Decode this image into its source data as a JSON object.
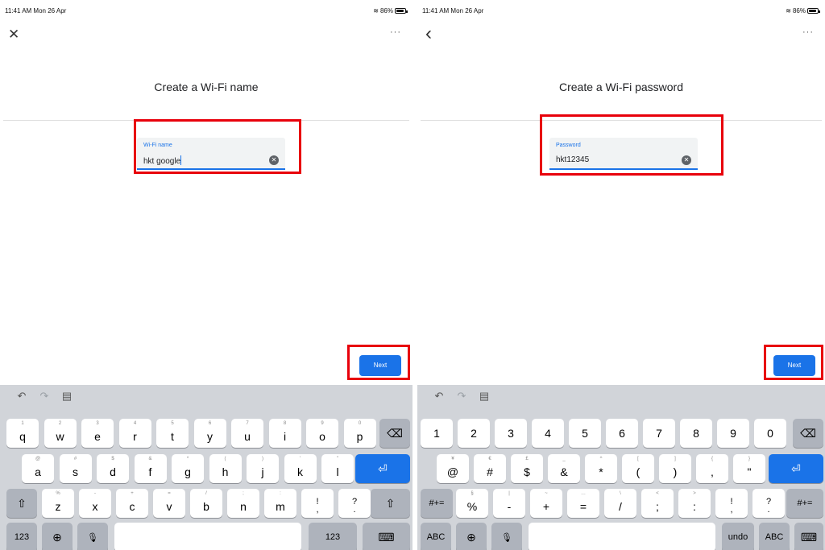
{
  "left": {
    "status": {
      "time": "11:41 AM  Mon 26 Apr",
      "battery": "86%"
    },
    "nav_icon": "close-icon",
    "nav_glyph": "✕",
    "more": "···",
    "title": "Create a Wi-Fi name",
    "field": {
      "label": "Wi-Fi name",
      "value": "hkt google"
    },
    "next_label": "Next",
    "keyboard": {
      "row1": [
        {
          "hint": "1",
          "key": "q"
        },
        {
          "hint": "2",
          "key": "w"
        },
        {
          "hint": "3",
          "key": "e"
        },
        {
          "hint": "4",
          "key": "r"
        },
        {
          "hint": "5",
          "key": "t"
        },
        {
          "hint": "6",
          "key": "y"
        },
        {
          "hint": "7",
          "key": "u"
        },
        {
          "hint": "8",
          "key": "i"
        },
        {
          "hint": "9",
          "key": "o"
        },
        {
          "hint": "0",
          "key": "p"
        }
      ],
      "row2": [
        {
          "hint": "@",
          "key": "a"
        },
        {
          "hint": "#",
          "key": "s"
        },
        {
          "hint": "$",
          "key": "d"
        },
        {
          "hint": "&",
          "key": "f"
        },
        {
          "hint": "*",
          "key": "g"
        },
        {
          "hint": "(",
          "key": "h"
        },
        {
          "hint": ")",
          "key": "j"
        },
        {
          "hint": "'",
          "key": "k"
        },
        {
          "hint": "\"",
          "key": "l"
        }
      ],
      "row3": [
        {
          "hint": "%",
          "key": "z"
        },
        {
          "hint": "-",
          "key": "x"
        },
        {
          "hint": "+",
          "key": "c"
        },
        {
          "hint": "=",
          "key": "v"
        },
        {
          "hint": "/",
          "key": "b"
        },
        {
          "hint": ";",
          "key": "n"
        },
        {
          "hint": ":",
          "key": "m"
        },
        {
          "hint": "",
          "key": "!\n,"
        },
        {
          "hint": "",
          "key": "?\n."
        }
      ],
      "numbers_label": "123",
      "numbers_label_right": "123"
    }
  },
  "right": {
    "status": {
      "time": "11:41 AM  Mon 26 Apr",
      "battery": "86%"
    },
    "nav_icon": "back-chevron-icon",
    "nav_glyph": "‹",
    "more": "···",
    "title": "Create a Wi-Fi password",
    "field": {
      "label": "Password",
      "value": "hkt12345"
    },
    "next_label": "Next",
    "keyboard": {
      "row1": [
        "1",
        "2",
        "3",
        "4",
        "5",
        "6",
        "7",
        "8",
        "9",
        "0"
      ],
      "row2": [
        {
          "hint": "¥",
          "key": "@"
        },
        {
          "hint": "€",
          "key": "#"
        },
        {
          "hint": "£",
          "key": "$"
        },
        {
          "hint": "_",
          "key": "&"
        },
        {
          "hint": "^",
          "key": "*"
        },
        {
          "hint": "[",
          "key": "("
        },
        {
          "hint": "]",
          "key": ")"
        },
        {
          "hint": "{",
          "key": ","
        },
        {
          "hint": "}",
          "key": "\""
        }
      ],
      "row3": [
        {
          "hint": "§",
          "key": "%"
        },
        {
          "hint": "|",
          "key": "-"
        },
        {
          "hint": "~",
          "key": "+"
        },
        {
          "hint": "…",
          "key": "="
        },
        {
          "hint": "\\",
          "key": "/"
        },
        {
          "hint": "<",
          "key": ";"
        },
        {
          "hint": ">",
          "key": ":"
        },
        {
          "hint": "",
          "key": "!\n,"
        },
        {
          "hint": "",
          "key": "?\n."
        }
      ],
      "symbols_label": "#+=",
      "abc_label": "ABC",
      "undo_label": "undo"
    }
  }
}
